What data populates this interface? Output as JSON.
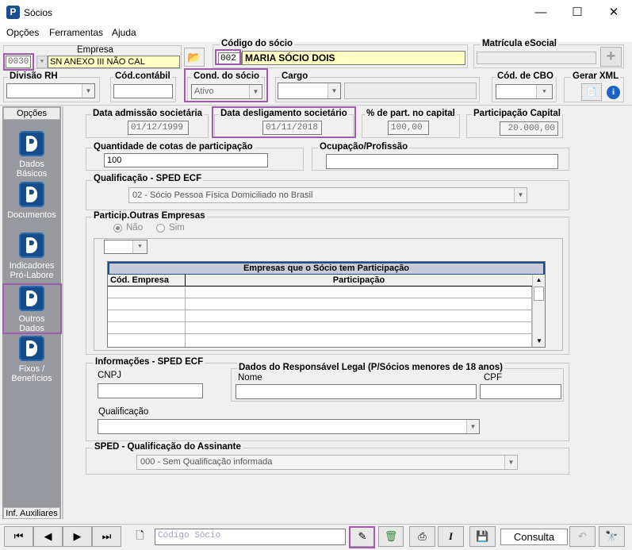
{
  "window": {
    "title": "Sócios",
    "minimize": "—",
    "maximize": "☐",
    "close": "✕"
  },
  "menu": [
    "Opções",
    "Ferramentas",
    "Ajuda"
  ],
  "empresa": {
    "label": "Empresa",
    "code": "0030",
    "name": "SN ANEXO III NÃO CAL"
  },
  "socio": {
    "label": "Código do sócio",
    "code": "002",
    "name": "MARIA SÓCIO DOIS"
  },
  "esocial": {
    "label": "Matrícula eSocial",
    "value": ""
  },
  "divisao": {
    "label": "Divisão RH"
  },
  "contabil": {
    "label": "Cód.contábil"
  },
  "cond": {
    "label": "Cond. do sócio",
    "value": "Ativo"
  },
  "cargo": {
    "label": "Cargo"
  },
  "cbo": {
    "label": "Cód. de CBO"
  },
  "xml": {
    "label": "Gerar XML"
  },
  "sidebar": {
    "header": "Opções",
    "items": [
      "Dados Básicos",
      "Documentos",
      "Indicadores Pró-Labore",
      "Outros Dados",
      "Fixos / Benefícios"
    ],
    "footer": "Inf. Auxiliares"
  },
  "fields": {
    "admissao": {
      "label": "Data admissão societária",
      "value": "01/12/1999"
    },
    "desligamento": {
      "label": "Data desligamento societário",
      "value": "01/11/2018"
    },
    "part": {
      "label": "% de part. no capital",
      "value": "100,00"
    },
    "capital": {
      "label": "Participação Capital",
      "value": "20.000,00"
    },
    "cotas": {
      "label": "Quantidade de cotas de participação",
      "value": "100"
    },
    "ocupacao": {
      "label": "Ocupação/Profissão",
      "value": ""
    }
  },
  "qualificacao": {
    "label": "Qualificação - SPED ECF",
    "value": "02 - Sócio Pessoa Física Domiciliado no Brasil"
  },
  "outras": {
    "label": "Particip.Outras Empresas",
    "radio_no": "Não",
    "radio_yes": "Sim",
    "grid_title": "Empresas que o Sócio tem Participação",
    "col1": "Cód. Empresa",
    "col2": "Participação"
  },
  "info": {
    "label": "Informações - SPED ECF",
    "cnpj": "CNPJ",
    "qualificacao": "Qualificação",
    "resp_label": "Dados do Responsável Legal (P/Sócios menores de 18 anos)",
    "nome": "Nome",
    "cpf": "CPF"
  },
  "assinante": {
    "label": "SPED - Qualificação do Assinante",
    "value": "000 - Sem Qualificação informada"
  },
  "toolbar": {
    "search_placeholder": "Código Sócio",
    "mode": "Consulta"
  },
  "colors": {
    "highlight": "#a05bb0",
    "brand": "#1c4d8c",
    "yellow_field": "#ffffc4"
  }
}
